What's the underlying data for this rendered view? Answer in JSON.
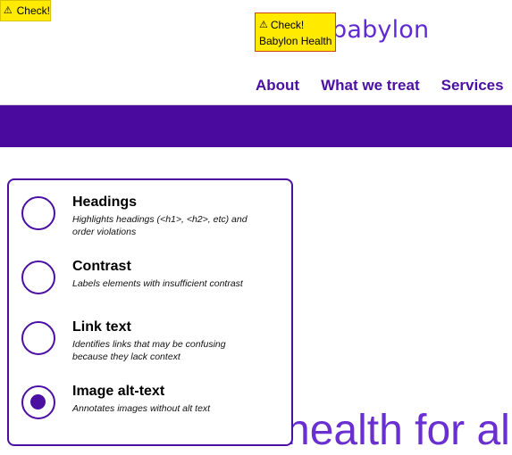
{
  "top_tag": {
    "warn_icon": "⚠",
    "label": "Check!"
  },
  "header": {
    "logo_text": "babylon",
    "check_overlay": {
      "warn_icon": "⚠",
      "title": "Check!",
      "subtitle": "Babylon Health"
    },
    "nav": [
      {
        "label": "About"
      },
      {
        "label": "What we treat"
      },
      {
        "label": "Services"
      }
    ]
  },
  "hero": {
    "partial_text": "health for all"
  },
  "panel": {
    "options": [
      {
        "title": "Headings",
        "description": "Highlights headings (<h1>, <h2>, etc) and order violations",
        "selected": false
      },
      {
        "title": "Contrast",
        "description": "Labels elements with insufficient contrast",
        "selected": false
      },
      {
        "title": "Link text",
        "description": "Identifies links that may be confusing because they lack context",
        "selected": false
      },
      {
        "title": "Image alt-text",
        "description": "Annotates images without alt text",
        "selected": true
      }
    ]
  },
  "colors": {
    "accent": "#4b10a3",
    "band": "#4b0a9e",
    "warning": "#ffea00"
  }
}
